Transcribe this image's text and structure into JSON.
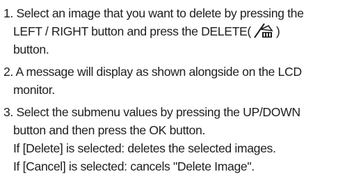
{
  "steps": [
    {
      "lines": [
        "1. Select an image that you want to delete by pressing the",
        "LEFT / RIGHT button and press the DELETE(",
        ")",
        "button."
      ],
      "icon": "delete-trash-icon"
    },
    {
      "lines": [
        "2. A message will display as shown alongside on the LCD",
        "monitor."
      ]
    },
    {
      "lines": [
        "3. Select the submenu values by pressing the UP/DOWN",
        "button and then press the OK button.",
        "If [Delete] is selected: deletes the selected images.",
        "If [Cancel] is selected: cancels \"Delete Image\"."
      ]
    }
  ]
}
